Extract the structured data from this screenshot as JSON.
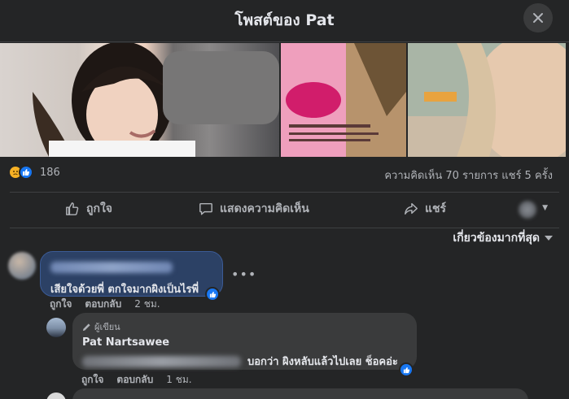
{
  "header": {
    "title": "โพสต์ของ Pat",
    "close_icon": "close-icon"
  },
  "stats": {
    "reaction_icons": [
      "sad-reaction-icon",
      "like-reaction-icon"
    ],
    "reaction_count": "186",
    "comments_shares": "ความคิดเห็น 70 รายการ  แชร์ 5 ครั้ง"
  },
  "actions": {
    "like": "ถูกใจ",
    "comment": "แสดงความคิดเห็น",
    "share": "แชร์"
  },
  "sort": {
    "label": "เกี่ยวข้องมากที่สุด"
  },
  "comments": [
    {
      "text": "เสียใจด้วยพี่ ตกใจมากผิงเป็นไรพี่",
      "like_label": "ถูกใจ",
      "reply_label": "ตอบกลับ",
      "time": "2 ชม."
    },
    {
      "author_badge": "ผู้เขียน",
      "author_name": "Pat Nartsawee",
      "text": "บอกว่า ผิงหลับแล้วไปเลย ช็อคอ่ะ",
      "like_label": "ถูกใจ",
      "reply_label": "ตอบกลับ",
      "time": "1 ชม."
    }
  ],
  "colors": {
    "background": "#242526",
    "accent": "#1877f2",
    "bubble": "#3a3b3c",
    "highlight_bubble": "#2c4165"
  }
}
